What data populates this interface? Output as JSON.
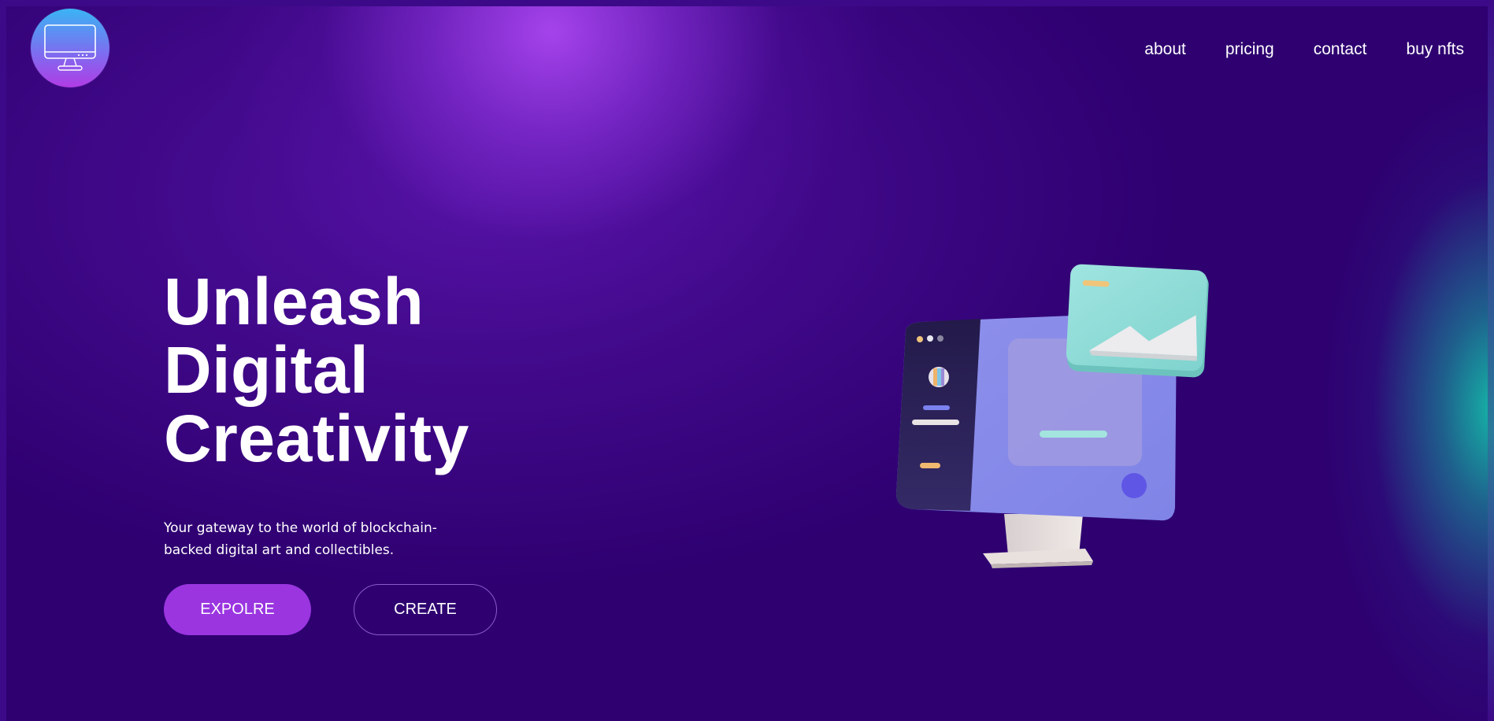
{
  "header": {
    "logo_icon": "monitor-icon",
    "nav": [
      {
        "label": "about"
      },
      {
        "label": "pricing"
      },
      {
        "label": "contact"
      },
      {
        "label": "buy nfts"
      }
    ]
  },
  "hero": {
    "title_lines": [
      "Unleash",
      "Digital",
      "Creativity"
    ],
    "subtitle": "Your gateway to the world of blockchain-backed digital art and collectibles.",
    "explore_label": "EXPOLRE",
    "create_label": "CREATE",
    "illustration": "3d-computer-monitor-with-image-card-illustration"
  },
  "colors": {
    "background": "#2e0070",
    "glow_purple": "#a946f0",
    "glow_teal": "#14bea9",
    "explore_button": "#9a35e0",
    "text": "#ffffff"
  }
}
